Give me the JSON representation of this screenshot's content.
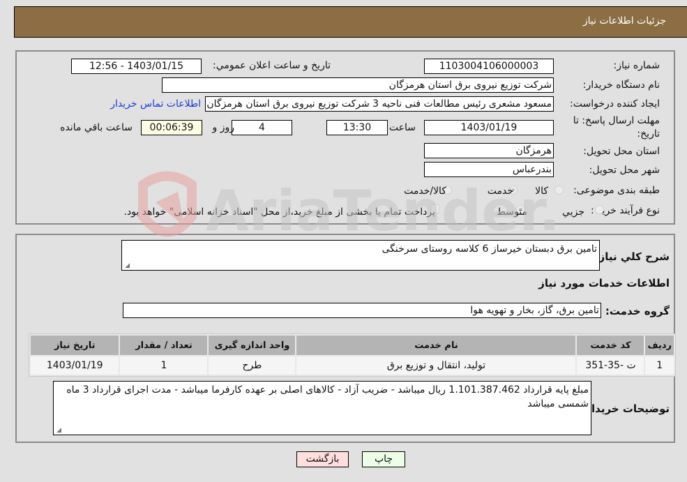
{
  "header": {
    "title": "جزئیات اطلاعات نیاز"
  },
  "form": {
    "need_number": {
      "label": "شماره نیاز:",
      "value": "1103004106000003"
    },
    "announce_datetime": {
      "label": "تاريخ و ساعت اعلان عمومي:",
      "value": "1403/01/15 - 12:56"
    },
    "buyer_org": {
      "label": "نام دستگاه خريدار:",
      "value": "شرکت توزیع نیروی برق استان هرمزگان"
    },
    "requester": {
      "label": "ايجاد کننده درخواست:",
      "value": "مسعود مشعری رئیس مطالعات فنی ناحیه 3 شرکت توزیع نیروی برق استان هرمزگان",
      "contact_link": "اطلاعات تماس خريدار"
    },
    "deadline": {
      "label": "مهلت ارسال پاسخ: تا تاريخ:",
      "date": "1403/01/19",
      "time_label": "ساعت",
      "time": "13:30",
      "days": "4",
      "days_label": "روز و",
      "remaining": "00:06:39",
      "remaining_label": "ساعت باقي مانده"
    },
    "delivery_province": {
      "label": "استان محل تحويل:",
      "value": "هرمزگان"
    },
    "delivery_city": {
      "label": "شهر محل تحويل:",
      "value": "بندرعباس"
    },
    "category": {
      "label": "طبقه بندی موضوعی:",
      "options": [
        "کالا",
        "خدمت",
        "کالا/خدمت"
      ],
      "selected": "خدمت"
    },
    "purchase_type": {
      "label": "نوع فرآيند خريد :",
      "options": [
        "جزيي",
        "متوسط"
      ],
      "selected": "متوسط",
      "treasury_note": "پرداخت تمام يا بخشی از مبلغ خريد،از محل \"اسناد خزانه اسلامی\" خواهد بود."
    }
  },
  "details": {
    "general_desc_label": "شرح کلي نياز:",
    "general_desc": "تامین برق دبستان خیرساز 6 کلاسه روستای سرخنگی",
    "services_heading": "اطلاعات خدمات مورد نیاز",
    "service_group_label": "گروه خدمت:",
    "service_group": "تامین برق، گاز، بخار و تهویه هوا",
    "table": {
      "headers": [
        "رديف",
        "کد خدمت",
        "نام خدمت",
        "واحد اندازه گيری",
        "تعداد / مقدار",
        "تاريخ نياز"
      ],
      "rows": [
        [
          "1",
          "ت -35-351",
          "تولید، انتقال و توزیع برق",
          "طرح",
          "1",
          "1403/01/19"
        ]
      ]
    },
    "buyer_notes_label": "توضيحات خريدار:",
    "buyer_notes": "مبلغ پایه قرارداد 1.101.387.462 ریال میباشد - ضریب آزاد - کالاهای اصلی بر عهده کارفرما میباشد - مدت اجرای قرارداد 3 ماه شمسی میباشد"
  },
  "buttons": {
    "print": "چاپ",
    "back": "بازگشت"
  },
  "watermark": {
    "text": "AriaTender.neT"
  }
}
